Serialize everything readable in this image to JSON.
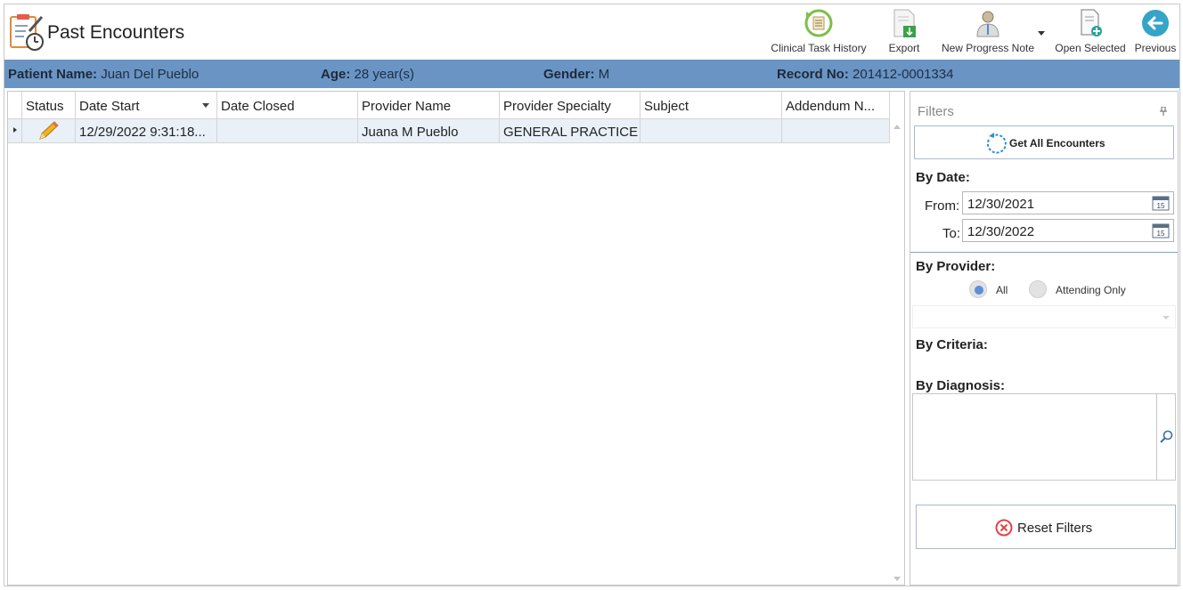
{
  "page": {
    "title": "Past Encounters"
  },
  "toolbar": {
    "clinical_task_history": "Clinical Task History",
    "export": "Export",
    "new_progress_note": "New Progress Note",
    "open_selected": "Open Selected",
    "previous": "Previous"
  },
  "patient": {
    "name_label": "Patient Name:",
    "name": "Juan Del Pueblo",
    "age_label": "Age:",
    "age": "28 year(s)",
    "gender_label": "Gender:",
    "gender": "M",
    "record_label": "Record No:",
    "record": "201412-0001334"
  },
  "grid": {
    "columns": [
      "Status",
      "Date Start",
      "Date Closed",
      "Provider Name",
      "Provider Specialty",
      "Subject",
      "Addendum N..."
    ],
    "rows": [
      {
        "status_icon": "pencil-icon",
        "date_start": "12/29/2022 9:31:18...",
        "date_closed": "",
        "provider_name": "Juana M Pueblo",
        "provider_specialty": "GENERAL PRACTICE",
        "subject": "",
        "addendum": ""
      }
    ]
  },
  "filters": {
    "title": "Filters",
    "get_all_label": "Get All Encounters",
    "by_date_label": "By Date:",
    "from_label": "From:",
    "from_value": "12/30/2021",
    "to_label": "To:",
    "to_value": "12/30/2022",
    "by_provider_label": "By Provider:",
    "radio_all": "All",
    "radio_attending": "Attending Only",
    "radio_selected": "All",
    "by_criteria_label": "By Criteria:",
    "by_diagnosis_label": "By Diagnosis:",
    "reset_label": "Reset Filters"
  },
  "colors": {
    "patient_bar": "#6a94c4",
    "selected_row": "#e9f0f8",
    "accent": "#5b8fd6",
    "reset_icon": "#e04343"
  }
}
